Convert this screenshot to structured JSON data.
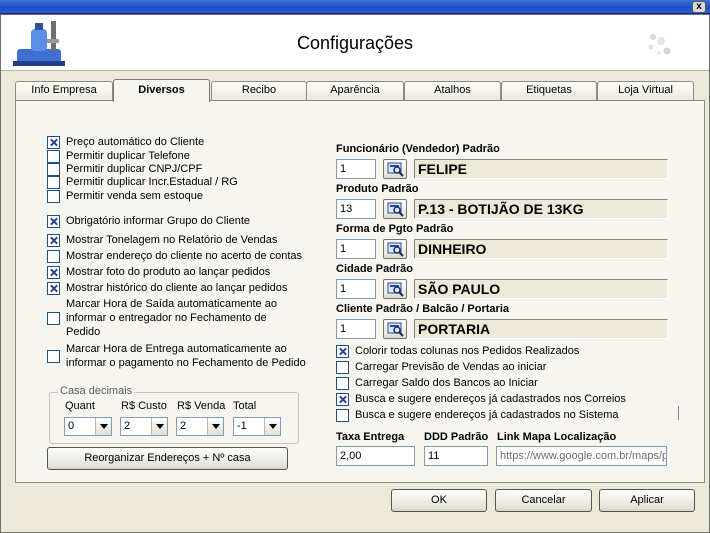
{
  "window": {
    "title": "Configurações",
    "close_glyph": "x"
  },
  "tabs": [
    {
      "label": "Info Empresa",
      "active": false
    },
    {
      "label": "Diversos",
      "active": true
    },
    {
      "label": "Recibo",
      "active": false
    },
    {
      "label": "Aparência",
      "active": false
    },
    {
      "label": "Atalhos",
      "active": false
    },
    {
      "label": "Etiquetas",
      "active": false
    },
    {
      "label": "Loja Virtual",
      "active": false
    }
  ],
  "left_options": [
    {
      "label": "Preço automático do Cliente",
      "checked": true
    },
    {
      "label": "Permitir duplicar Telefone",
      "checked": false
    },
    {
      "label": "Permitir duplicar CNPJ/CPF",
      "checked": false
    },
    {
      "label": "Permitir duplicar Incr.Estadual / RG",
      "checked": false
    },
    {
      "label": "Permitir venda sem estoque",
      "checked": false
    },
    {
      "label": "Obrigatório informar Grupo do Cliente",
      "checked": true
    },
    {
      "label": "Mostrar Tonelagem no Relatório de Vendas",
      "checked": true
    },
    {
      "label": "Mostrar endereço do cliente no acerto de contas",
      "checked": false
    },
    {
      "label": "Mostrar foto do produto ao lançar pedidos",
      "checked": true
    },
    {
      "label": "Mostrar histórico do cliente ao lançar pedidos",
      "checked": true
    },
    {
      "label": "Marcar Hora de Saída automaticamente ao informar o entregador no Fechamento de Pedido",
      "checked": false
    },
    {
      "label": "Marcar Hora de Entrega automaticamente ao informar o pagamento no Fechamento de Pedido",
      "checked": false
    }
  ],
  "casa_decimais": {
    "legend": "Casa decimais",
    "columns": [
      {
        "label": "Quant",
        "value": "0"
      },
      {
        "label": "R$ Custo",
        "value": "2"
      },
      {
        "label": "R$ Venda",
        "value": "2"
      },
      {
        "label": "Total",
        "value": "-1"
      }
    ]
  },
  "reorganize_button": "Reorganizar Endereços + Nº casa",
  "defaults": [
    {
      "label": "Funcionário (Vendedor) Padrão",
      "code": "1",
      "name": "FELIPE"
    },
    {
      "label": "Produto Padrão",
      "code": "13",
      "name": "P.13 - BOTIJÃO DE 13KG"
    },
    {
      "label": "Forma de Pgto Padrão",
      "code": "1",
      "name": "DINHEIRO"
    },
    {
      "label": "Cidade Padrão",
      "code": "1",
      "name": "SÃO PAULO"
    },
    {
      "label": "Cliente Padrão / Balcão / Portaria",
      "code": "1",
      "name": "PORTARIA"
    }
  ],
  "right_options": [
    {
      "label": "Colorir todas colunas nos Pedidos Realizados",
      "checked": true
    },
    {
      "label": "Carregar Previsão de Vendas ao iniciar",
      "checked": false
    },
    {
      "label": "Carregar Saldo dos Bancos ao Iniciar",
      "checked": false
    },
    {
      "label": "Busca e sugere endereços já cadastrados nos Correios",
      "checked": true
    },
    {
      "label": "Busca e sugere endereços já cadastrados no Sistema",
      "checked": false
    }
  ],
  "bottom_fields": {
    "taxa_label": "Taxa Entrega",
    "taxa_value": "2,00",
    "ddd_label": "DDD Padrão",
    "ddd_value": "11",
    "link_label": "Link Mapa Localização",
    "link_placeholder": "https://www.google.com.br/maps/p"
  },
  "footer": {
    "ok": "OK",
    "cancel": "Cancelar",
    "apply": "Aplicar"
  }
}
